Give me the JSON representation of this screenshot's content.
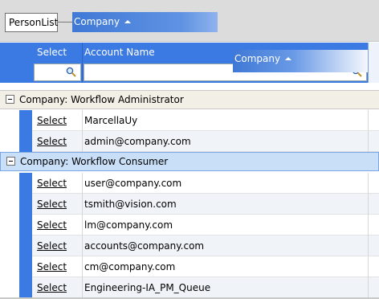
{
  "group_by_panel": {
    "chips": [
      {
        "label": "PersonList"
      },
      {
        "label": "Company"
      }
    ]
  },
  "grid": {
    "columns": {
      "select": "Select",
      "account_name": "Account Name"
    },
    "dragging_column": "Company",
    "filter_icon": "magnifier-icon",
    "groups": [
      {
        "label": "Company: Workflow Administrator",
        "rows": [
          {
            "select": "Select",
            "account": "MarcellaUy"
          },
          {
            "select": "Select",
            "account": "admin@company.com"
          }
        ]
      },
      {
        "label": "Company: Workflow Consumer",
        "rows": [
          {
            "select": "Select",
            "account": "user@company.com"
          },
          {
            "select": "Select",
            "account": "tsmith@vision.com"
          },
          {
            "select": "Select",
            "account": "lm@company.com"
          },
          {
            "select": "Select",
            "account": "accounts@company.com"
          },
          {
            "select": "Select",
            "account": "cm@company.com"
          },
          {
            "select": "Select",
            "account": "Engineering-IA_PM_Queue"
          }
        ]
      }
    ]
  },
  "colors": {
    "header_blue": "#3c7ae3",
    "selected_group_bg": "#c9def7"
  }
}
